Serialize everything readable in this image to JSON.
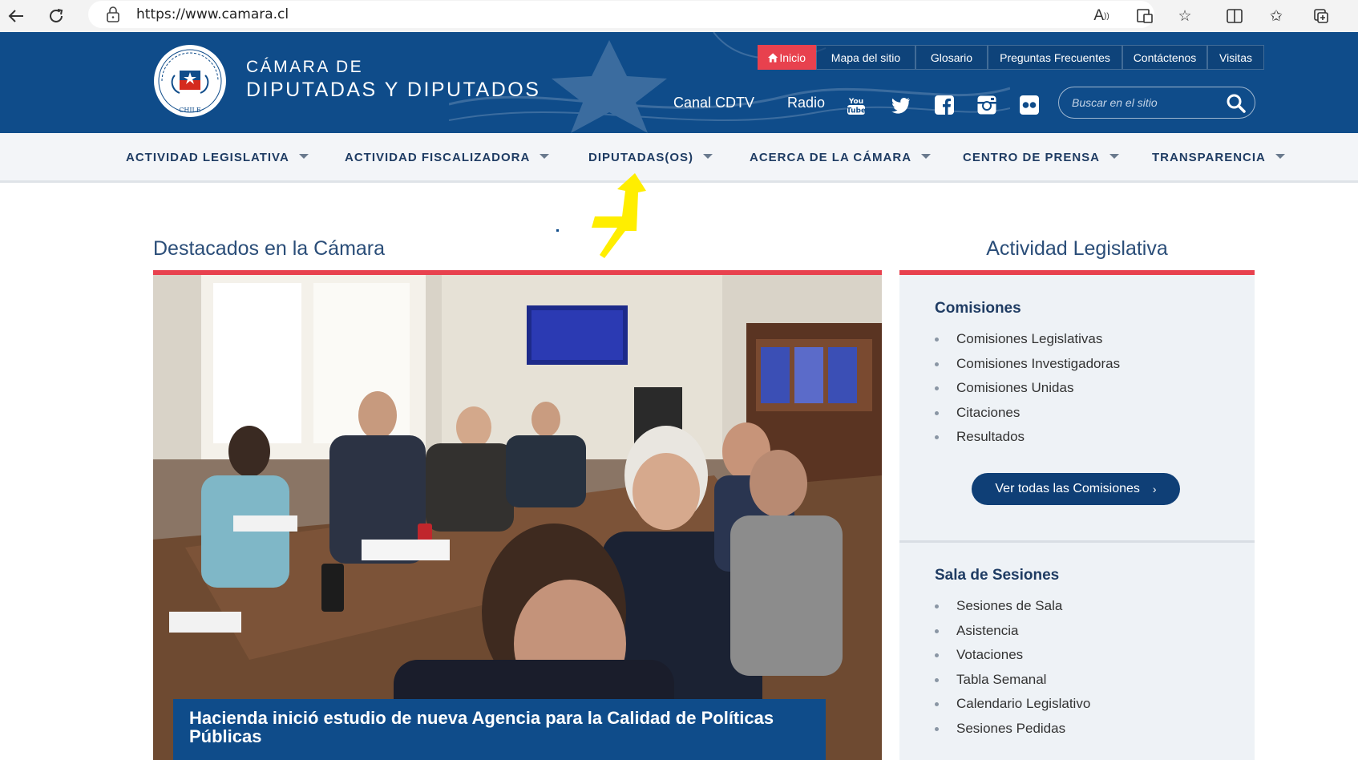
{
  "browser": {
    "url": "https://www.camara.cl"
  },
  "header": {
    "org_line1": "CÁMARA DE",
    "org_line2": "DIPUTADAS Y DIPUTADOS",
    "seal_text_top": "CÁMARA DE DIPUTADAS Y DIPUTADOS",
    "seal_text_bottom": "CHILE",
    "top_nav": [
      "Inicio",
      "Mapa del sitio",
      "Glosario",
      "Preguntas Frecuentes",
      "Contáctenos",
      "Visitas"
    ],
    "media_links": [
      "Canal CDTV",
      "Radio"
    ],
    "social_icons": [
      "youtube-icon",
      "twitter-icon",
      "facebook-icon",
      "instagram-icon",
      "flickr-icon"
    ],
    "search_placeholder": "Buscar en el sitio"
  },
  "main_nav": [
    "ACTIVIDAD LEGISLATIVA",
    "ACTIVIDAD FISCALIZADORA",
    "DIPUTADAS(OS)",
    "ACERCA DE LA CÁMARA",
    "CENTRO DE PRENSA",
    "TRANSPARENCIA"
  ],
  "left_section": {
    "title": "Destacados en la Cámara",
    "caption": "Hacienda inició estudio de nueva Agencia para la Calidad de Políticas Públicas"
  },
  "right_section": {
    "title": "Actividad Legislativa",
    "groups": [
      {
        "title": "Comisiones",
        "items": [
          "Comisiones Legislativas",
          "Comisiones Investigadoras",
          "Comisiones Unidas",
          "Citaciones",
          "Resultados"
        ],
        "button": "Ver todas las Comisiones"
      },
      {
        "title": "Sala de Sesiones",
        "items": [
          "Sesiones de Sala",
          "Asistencia",
          "Votaciones",
          "Tabla Semanal",
          "Calendario Legislativo",
          "Sesiones Pedidas"
        ]
      }
    ]
  },
  "colors": {
    "header_blue": "#0f4c8a",
    "accent_red": "#e8414e",
    "nav_text": "#1f3c63",
    "annotation_yellow": "#ffee00"
  }
}
